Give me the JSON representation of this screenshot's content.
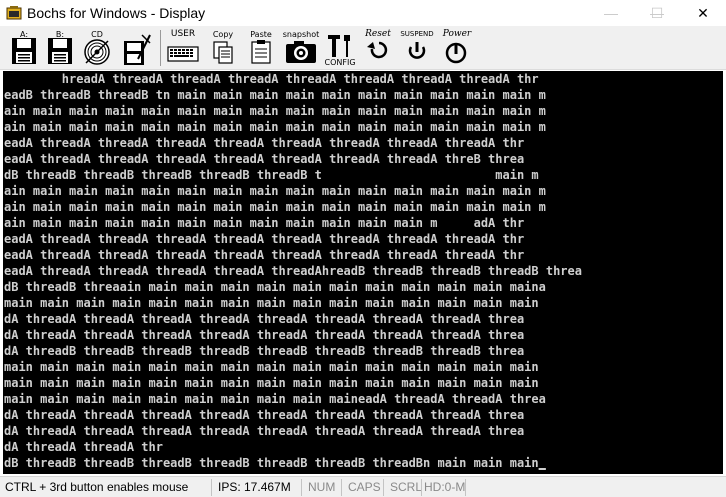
{
  "window": {
    "title": "Bochs for Windows - Display",
    "minimize_glyph": "—",
    "maximize_glyph": "☐",
    "close_glyph": "✕"
  },
  "toolbar": {
    "floppy_a": "A:",
    "floppy_b": "B:",
    "cdrom": "CD",
    "user": "USER",
    "copy": "Copy",
    "paste": "Paste",
    "snapshot": "snapshot",
    "config": "CONFIG",
    "reset": "Reset",
    "suspend": "SUSPEND",
    "power": "Power"
  },
  "console": {
    "lines": [
      "        hreadA threadA threadA threadA threadA threadA threadA threadA thr",
      "eadB threadB threadB tn main main main main main main main main main main m",
      "ain main main main main main main main main main main main main main main m",
      "ain main main main main main main main main main main main main main main m",
      "eadA threadA threadA threadA threadA threadA threadA threadA threadA thr",
      "eadA threadA threadA threadA threadA threadA threadA threadA threB threa",
      "dB threadB threadB threadB threadB threadB t                        main m",
      "ain main main main main main main main main main main main main main main m",
      "ain main main main main main main main main main main main main main main m",
      "ain main main main main main main main main main main main m     adA thr",
      "eadA threadA threadA threadA threadA threadA threadA threadA threadA thr",
      "eadA threadA threadA threadA threadA threadA threadA threadA threadA thr",
      "eadA threadA threadA threadA threadA threadAhreadB threadB threadB threadB threa",
      "dB threadB threaain main main main main main main main main main main maina",
      "main main main main main main main main main main main main main main main",
      "dA threadA threadA threadA threadA threadA threadA threadA threadA threa",
      "dA threadA threadA threadA threadA threadA threadA threadA threadA threa",
      "dA threadB threadB threadB threadB threadB threadB threadB threadB threa",
      "main main main main main main main main main main main main main main main",
      "main main main main main main main main main main main main main main main",
      "main main main main main main main main main maineadA threadA threadA threa",
      "dA threadA threadA threadA threadA threadA threadA threadA threadA threa",
      "dA threadA threadA threadA threadA threadA threadA threadA threadA threa",
      "dA threadA threadA thr",
      "dB threadB threadB threadB threadB threadB threadB threadBn main main main"
    ],
    "cursor": "_"
  },
  "status": {
    "mouse_hint": "CTRL + 3rd button enables mouse",
    "ips": "IPS: 17.467M",
    "num": "NUM",
    "caps": "CAPS",
    "scrl": "SCRL",
    "hd": "HD:0-M"
  }
}
